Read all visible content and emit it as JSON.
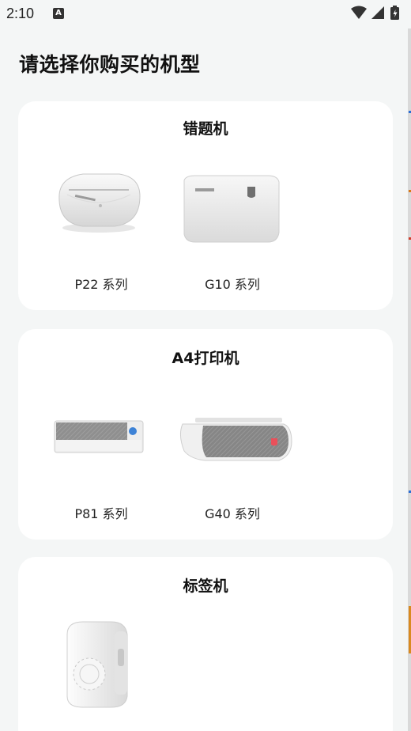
{
  "status_bar": {
    "time": "2:10",
    "notification_icon_letter": "A"
  },
  "page": {
    "title": "请选择你购买的机型"
  },
  "sections": [
    {
      "title": "错题机",
      "devices": [
        {
          "label": "P22 系列"
        },
        {
          "label": "G10 系列"
        }
      ]
    },
    {
      "title": "A4打印机",
      "devices": [
        {
          "label": "P81 系列"
        },
        {
          "label": "G40 系列"
        }
      ]
    },
    {
      "title": "标签机",
      "devices": [
        {
          "label": ""
        }
      ]
    }
  ],
  "icons": [
    "wifi-icon",
    "cellular-signal-icon",
    "battery-charging-icon",
    "notification-a-icon"
  ]
}
